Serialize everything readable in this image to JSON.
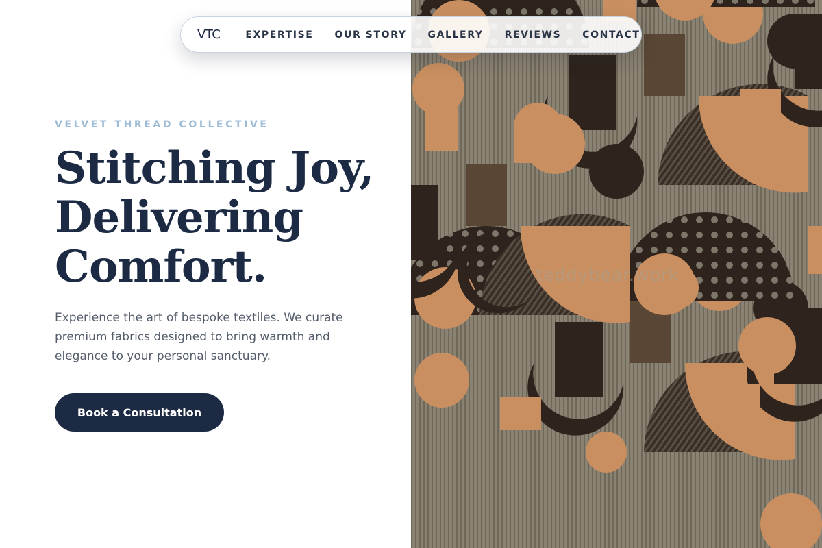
{
  "nav": {
    "logo": "VTC",
    "links": [
      "EXPERTISE",
      "OUR STORY",
      "GALLERY",
      "REVIEWS",
      "CONTACT"
    ]
  },
  "hero": {
    "eyebrow": "VELVET THREAD COLLECTIVE",
    "headline_lines": [
      "Stitching Joy,",
      "Delivering",
      "Comfort."
    ],
    "description": "Experience the art of bespoke textiles. We curate premium fabrics designed to bring warmth and elegance to your personal sanctuary.",
    "cta_label": "Book a Consultation"
  },
  "image": {
    "watermark": "teddybear.work"
  },
  "colors": {
    "primary": "#1c2a44",
    "eyebrow": "#9fbcd6",
    "body_text": "#545d6b",
    "fabric_tan": "#c98f60",
    "fabric_dark": "#2e241d",
    "fabric_grey": "#817a6c"
  }
}
